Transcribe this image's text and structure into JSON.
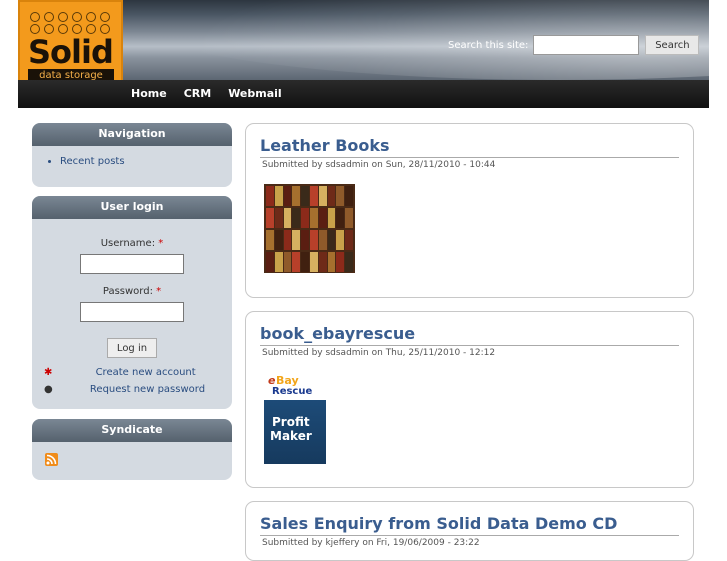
{
  "logo": {
    "brand": "Solid",
    "subtitle": "data storage"
  },
  "search": {
    "label": "Search this site:",
    "value": "",
    "button": "Search"
  },
  "primary_links": [
    "Home",
    "CRM",
    "Webmail"
  ],
  "navigation": {
    "title": "Navigation",
    "items": [
      "Recent posts"
    ]
  },
  "login": {
    "title": "User login",
    "username_label": "Username:",
    "password_label": "Password:",
    "required_mark": "*",
    "button": "Log in",
    "create_account": "Create new account",
    "request_password": "Request new password"
  },
  "syndicate": {
    "title": "Syndicate",
    "icon": "rss-feed-icon"
  },
  "nodes": [
    {
      "title": "Leather Books",
      "meta": "Submitted by sdsadmin on Sun, 28/11/2010 - 10:44"
    },
    {
      "title": "book_ebayrescue",
      "meta": "Submitted by sdsadmin on Thu, 25/11/2010 - 12:12",
      "cover": {
        "brand_e": "e",
        "brand_bay": "Bay",
        "brand_rescue": "Rescue",
        "line1": "Profit",
        "line2": "Maker"
      }
    },
    {
      "title": "Sales Enquiry from Solid Data Demo CD",
      "meta": "Submitted by kjeffery on Fri, 19/06/2009 - 23:22"
    }
  ],
  "colors": {
    "accent_orange": "#f39a1c",
    "link_blue": "#3a5d8f",
    "sidebar_bg": "#d4dae1"
  }
}
